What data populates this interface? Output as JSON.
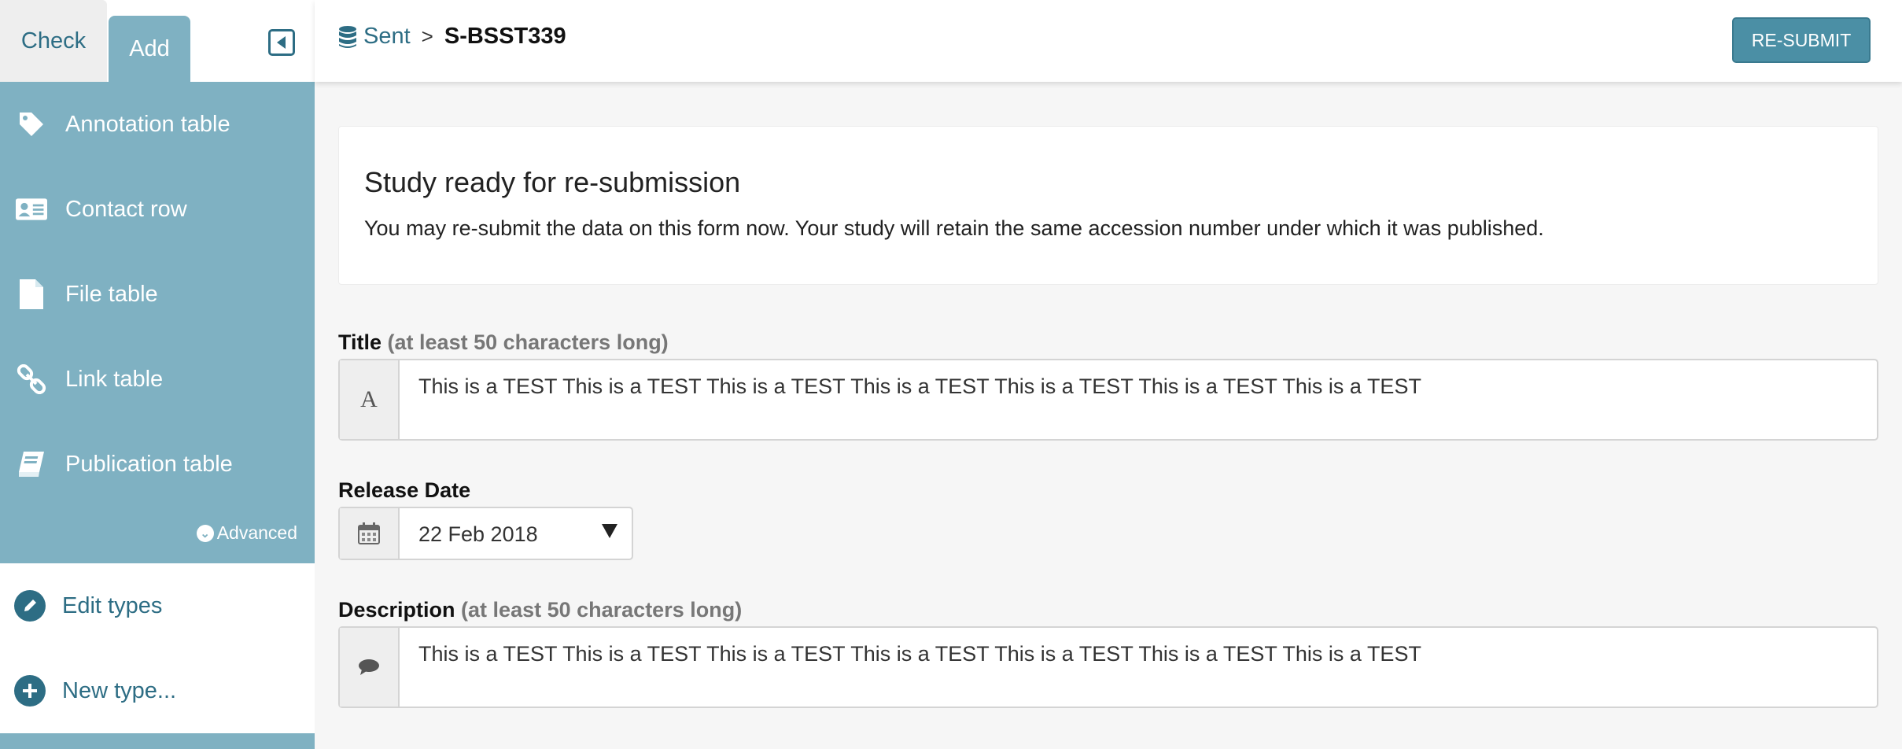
{
  "tabs": {
    "check": "Check",
    "add": "Add"
  },
  "nav": {
    "items": [
      {
        "label": "Annotation table",
        "icon": "tag-icon"
      },
      {
        "label": "Contact row",
        "icon": "contact-card-icon"
      },
      {
        "label": "File table",
        "icon": "file-icon"
      },
      {
        "label": "Link table",
        "icon": "link-icon"
      },
      {
        "label": "Publication table",
        "icon": "book-icon"
      }
    ],
    "advanced": "Advanced"
  },
  "types": {
    "edit": "Edit types",
    "new": "New type..."
  },
  "header": {
    "crumb_root": "Sent",
    "crumb_separator": ">",
    "accession": "S-BSST339",
    "resubmit_label": "RE-SUBMIT"
  },
  "notice": {
    "title": "Study ready for re-submission",
    "text": "You may re-submit the data on this form now. Your study will retain the same accession number under which it was published."
  },
  "form": {
    "title_label": "Title",
    "title_hint": "(at least 50 characters long)",
    "title_value": "This is a TEST This is a TEST This is a TEST This is a TEST This is a TEST This is a TEST This is a TEST",
    "title_addon": "A",
    "release_label": "Release Date",
    "release_value": "22 Feb 2018",
    "description_label": "Description",
    "description_hint": "(at least 50 characters long)",
    "description_value": "This is a TEST This is a TEST This is a TEST This is a TEST This is a TEST This is a TEST This is a TEST"
  },
  "colors": {
    "sidebar": "#7fb1c2",
    "accent": "#2d6d84",
    "button": "#4b8fa5"
  }
}
